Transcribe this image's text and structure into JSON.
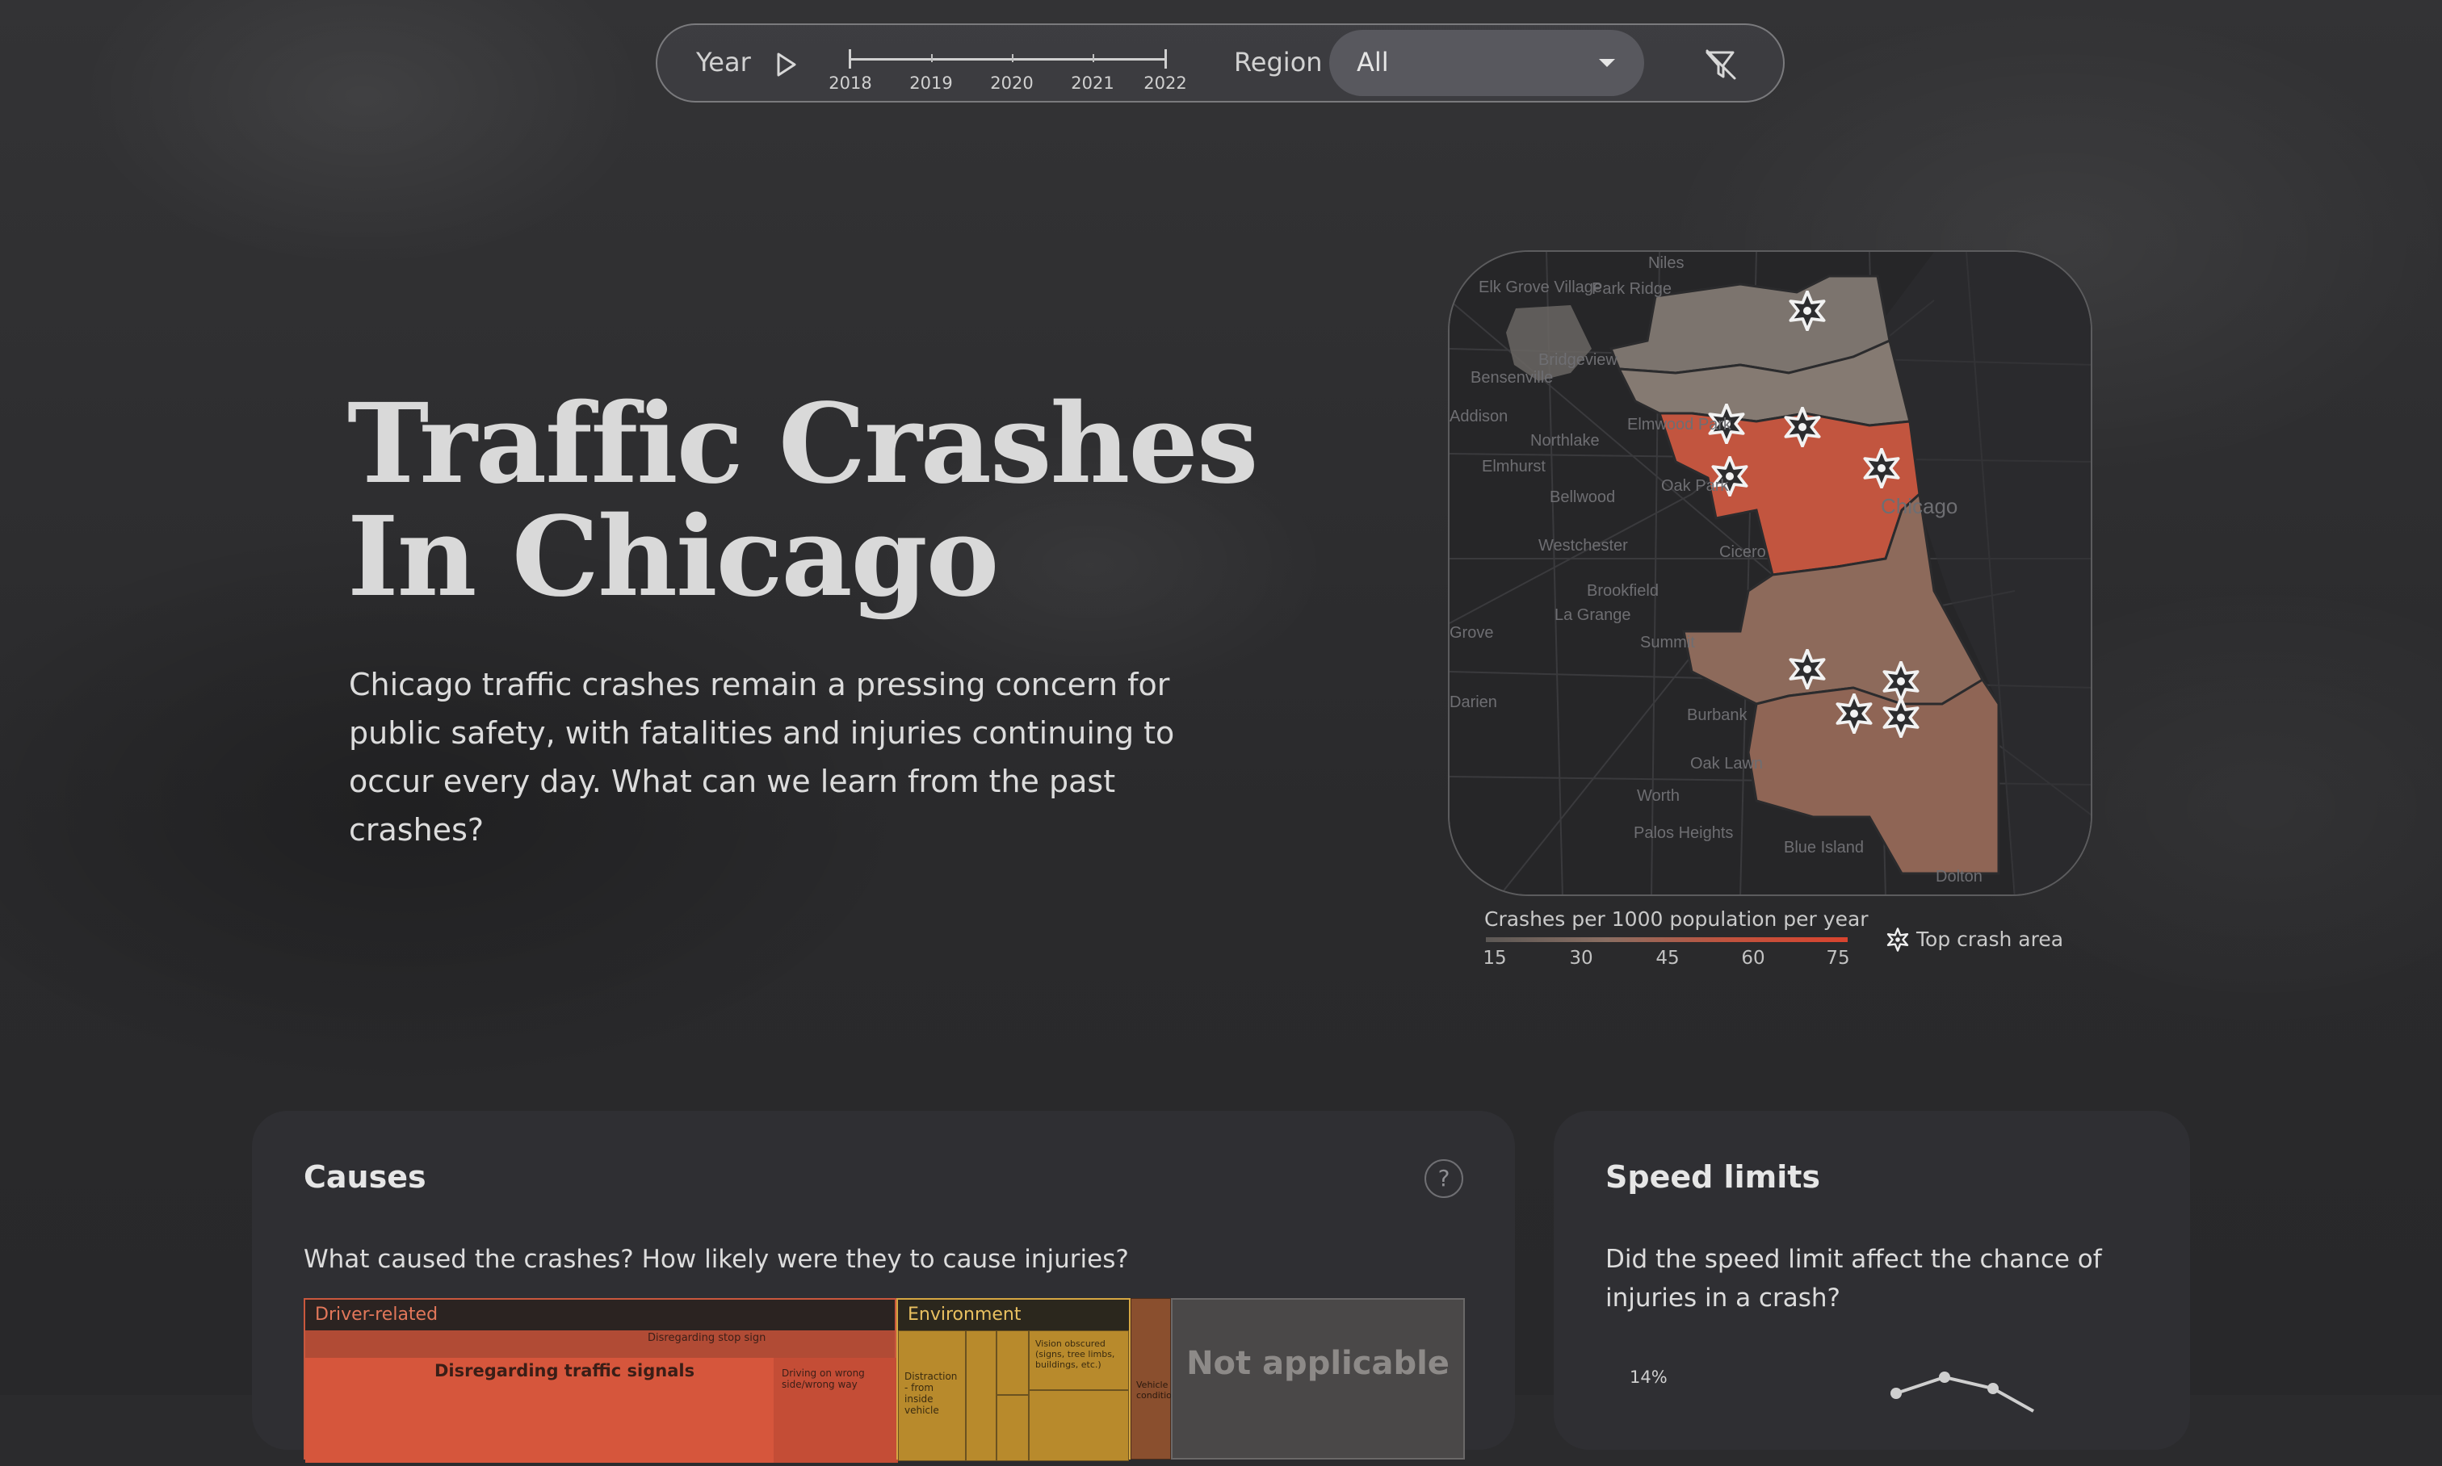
{
  "toolbar": {
    "year_label": "Year",
    "years": [
      "2018",
      "2019",
      "2020",
      "2021",
      "2022"
    ],
    "region_label": "Region",
    "region_value": "All"
  },
  "hero": {
    "title_line1": "Traffic Crashes",
    "title_line2": "In Chicago",
    "description": "Chicago traffic crashes remain a pressing concern for public safety, with fatalities and injuries continuing to occur every day. What can we learn from the past crashes?"
  },
  "map": {
    "place_labels": [
      "Niles",
      "Park Ridge",
      "Elk Grove Village",
      "Bensenville",
      "Northlake",
      "Elmwood Park",
      "Elmhurst",
      "Oak Park",
      "Bellwood",
      "Westchester",
      "Cicero",
      "Brookfield",
      "La Grange",
      "Summit",
      "Darien",
      "Burbank",
      "Oak Lawn",
      "Worth",
      "Palos Heights",
      "Blue Island",
      "Dolton",
      "Chicago",
      "Addison",
      "Grove",
      "Bridgeview"
    ],
    "legend_title": "Crashes per 1000 population per year",
    "legend_ticks": [
      "15",
      "30",
      "45",
      "60",
      "75"
    ],
    "top_area_label": "Top crash area",
    "colors": {
      "low": "#8a8077",
      "mid": "#8d6a5b",
      "high": "#c2553f"
    }
  },
  "causes": {
    "title": "Causes",
    "help": "?",
    "question": "What caused the crashes? How likely were they to cause injuries?",
    "treemap": {
      "driver_label": "Driver-related",
      "driver_main": "Disregarding traffic signals",
      "driver_small": "Disregarding stop sign",
      "driver_side": "Driving on wrong side/wrong way",
      "environment_label": "Environment",
      "env_distraction": "Distraction - from inside vehicle",
      "env_vision": "Vision obscured (signs, tree limbs, buildings, etc.)",
      "vehicle_label": "Vehicle condition",
      "na_label": "Not applicable"
    }
  },
  "speed": {
    "title": "Speed limits",
    "question": "Did the speed limit affect the chance of injuries in a crash?",
    "y_tick_top": "14%"
  }
}
